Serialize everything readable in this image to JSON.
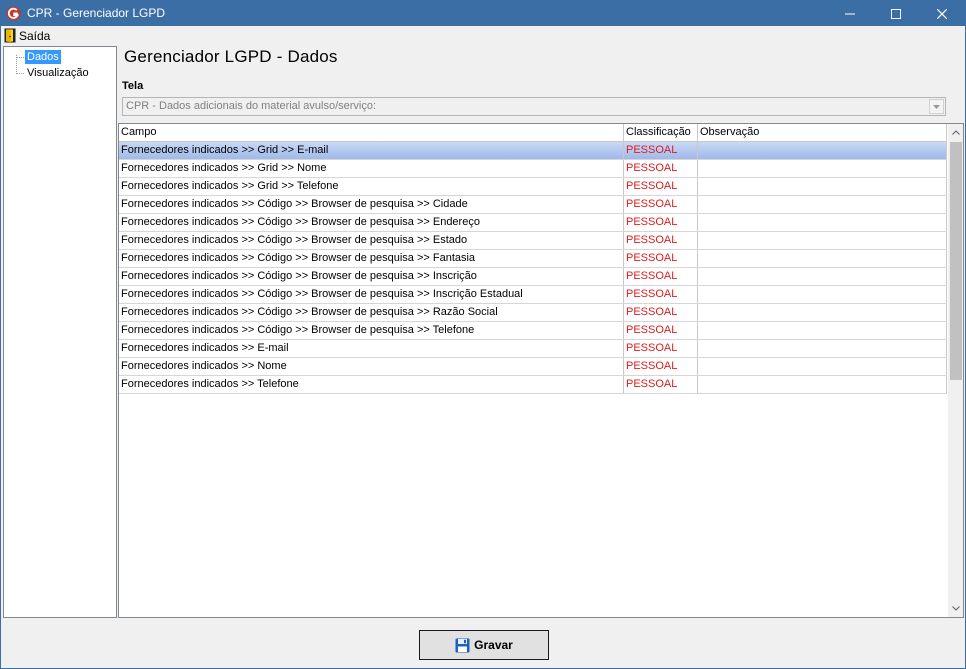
{
  "window": {
    "title": "CPR - Gerenciador LGPD",
    "icon": "app-logo-icon",
    "controls": [
      "minimize-icon",
      "maximize-icon",
      "close-icon"
    ]
  },
  "menu": {
    "items": [
      {
        "label": "Saída",
        "icon": "exit-door-icon"
      }
    ]
  },
  "tree": {
    "items": [
      {
        "label": "Dados",
        "selected": true
      },
      {
        "label": "Visualização",
        "selected": false
      }
    ]
  },
  "main": {
    "heading": "Gerenciador LGPD - Dados",
    "tela_label": "Tela",
    "tela_value": "CPR - Dados adicionais do material avulso/serviço:"
  },
  "grid": {
    "columns": [
      "Campo",
      "Classificação",
      "Observação"
    ],
    "rows": [
      {
        "campo": "Fornecedores indicados >> Grid >> E-mail",
        "classificacao": "PESSOAL",
        "observacao": ""
      },
      {
        "campo": "Fornecedores indicados >> Grid >> Nome",
        "classificacao": "PESSOAL",
        "observacao": ""
      },
      {
        "campo": "Fornecedores indicados >> Grid >> Telefone",
        "classificacao": "PESSOAL",
        "observacao": ""
      },
      {
        "campo": "Fornecedores indicados >> Código >> Browser de pesquisa >> Cidade",
        "classificacao": "PESSOAL",
        "observacao": ""
      },
      {
        "campo": "Fornecedores indicados >> Código >> Browser de pesquisa >> Endereço",
        "classificacao": "PESSOAL",
        "observacao": ""
      },
      {
        "campo": "Fornecedores indicados >> Código >> Browser de pesquisa >> Estado",
        "classificacao": "PESSOAL",
        "observacao": ""
      },
      {
        "campo": "Fornecedores indicados >> Código >> Browser de pesquisa >> Fantasia",
        "classificacao": "PESSOAL",
        "observacao": ""
      },
      {
        "campo": "Fornecedores indicados >> Código >> Browser de pesquisa >> Inscrição",
        "classificacao": "PESSOAL",
        "observacao": ""
      },
      {
        "campo": "Fornecedores indicados >> Código >> Browser de pesquisa >> Inscrição Estadual",
        "classificacao": "PESSOAL",
        "observacao": ""
      },
      {
        "campo": "Fornecedores indicados >> Código >> Browser de pesquisa >> Razão Social",
        "classificacao": "PESSOAL",
        "observacao": ""
      },
      {
        "campo": "Fornecedores indicados >> Código >> Browser de pesquisa >> Telefone",
        "classificacao": "PESSOAL",
        "observacao": ""
      },
      {
        "campo": "Fornecedores indicados >> E-mail",
        "classificacao": "PESSOAL",
        "observacao": ""
      },
      {
        "campo": "Fornecedores indicados >> Nome",
        "classificacao": "PESSOAL",
        "observacao": ""
      },
      {
        "campo": "Fornecedores indicados >> Telefone",
        "classificacao": "PESSOAL",
        "observacao": ""
      }
    ],
    "selected_row": 0
  },
  "footer": {
    "save_button": "Gravar",
    "save_icon": "floppy-disk-icon"
  },
  "colors": {
    "titlebar": "#3b6ea5",
    "selection": "#3399ff",
    "classification_text": "#e01b1b",
    "selected_row": "#b4caf0"
  }
}
